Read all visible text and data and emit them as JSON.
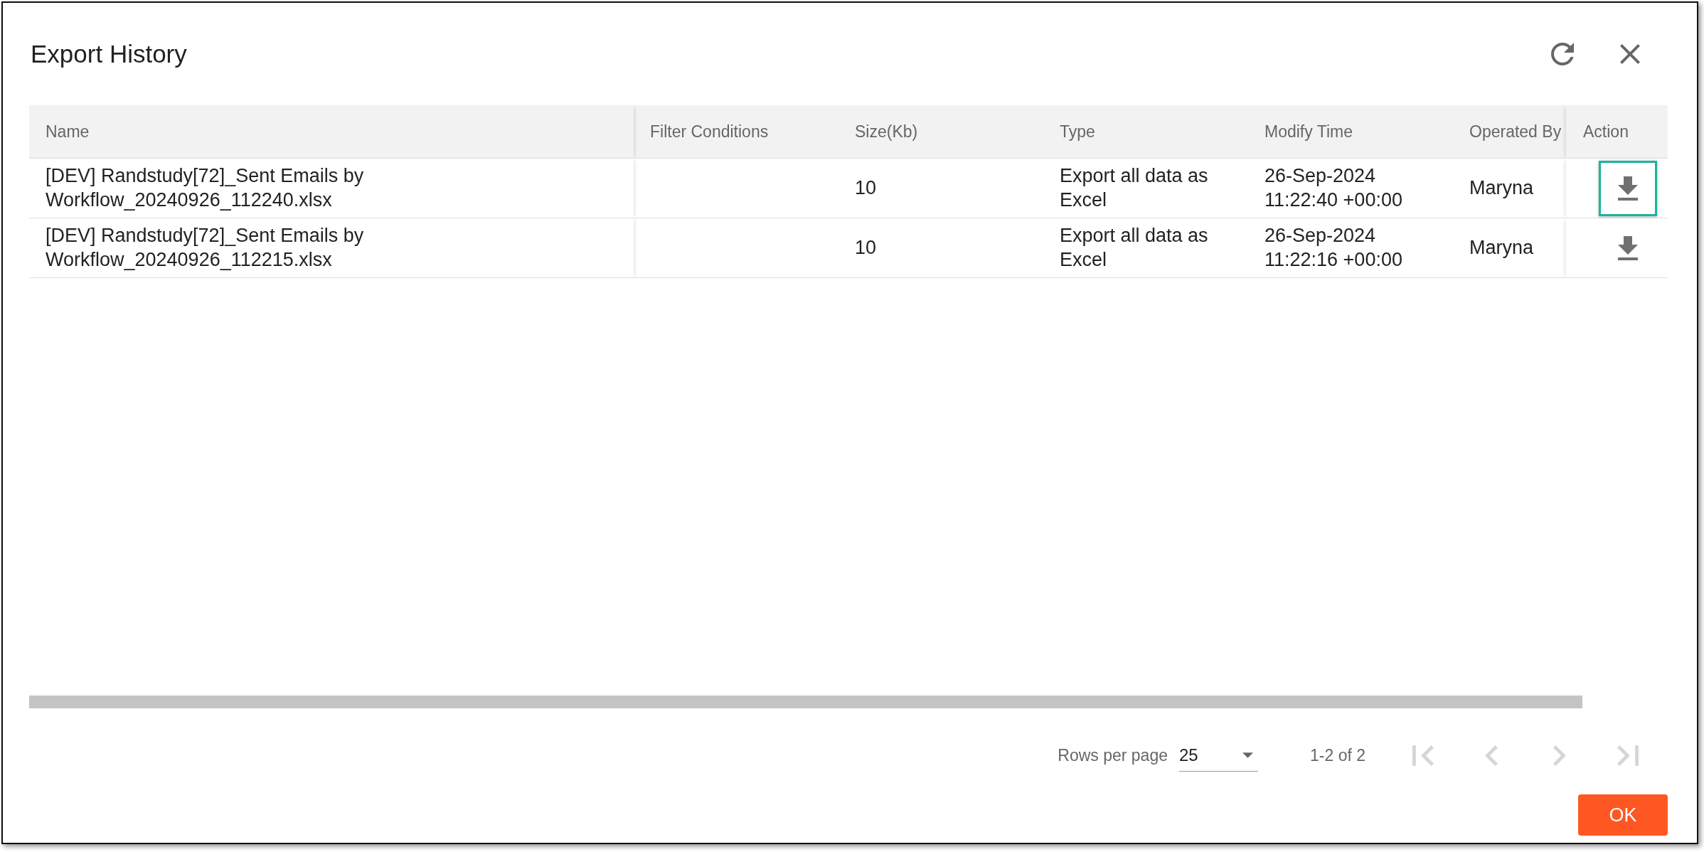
{
  "dialog": {
    "title": "Export History"
  },
  "table": {
    "columns": [
      "Name",
      "Filter Conditions",
      "Size(Kb)",
      "Type",
      "Modify Time",
      "Operated By",
      "Action"
    ],
    "rows": [
      {
        "name": "[DEV] Randstudy[72]_Sent Emails by Workflow_20240926_112240.xlsx",
        "size": "10",
        "type": "Export all data as Excel",
        "modify_time": "26-Sep-2024 11:22:40 +00:00",
        "operated_by": "Maryna",
        "focused": true
      },
      {
        "name": "[DEV] Randstudy[72]_Sent Emails by Workflow_20240926_112215.xlsx",
        "size": "10",
        "type": "Export all data as Excel",
        "modify_time": "26-Sep-2024 11:22:16 +00:00",
        "operated_by": "Maryna",
        "focused": false
      }
    ]
  },
  "pagination": {
    "rows_per_page_label": "Rows per page",
    "rows_per_page": "25",
    "range": "1-2 of 2",
    "buttons": [
      {
        "kind": "first",
        "disabled": true
      },
      {
        "kind": "prev",
        "disabled": true
      },
      {
        "kind": "next",
        "disabled": true
      },
      {
        "kind": "last",
        "disabled": true
      }
    ]
  },
  "footer": {
    "ok_button": "OK"
  }
}
